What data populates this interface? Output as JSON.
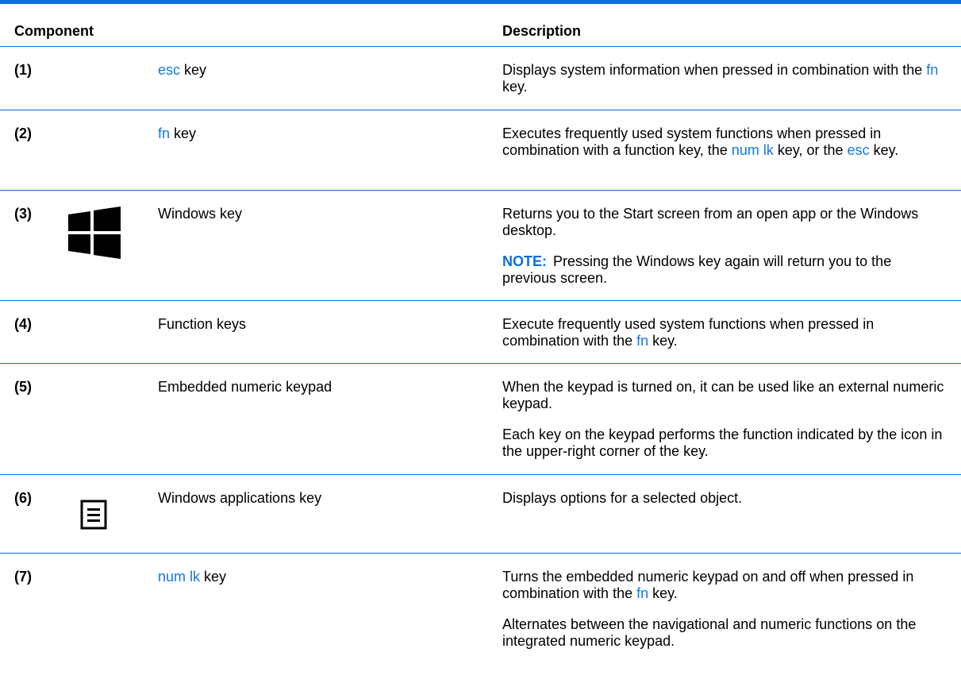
{
  "header": {
    "component": "Component",
    "description": "Description"
  },
  "rows": [
    {
      "num": "(1)",
      "component": {
        "prefix": "esc",
        "suffix": " key"
      },
      "description": [
        {
          "parts": [
            "Displays system information when pressed in combination with the ",
            "fn",
            " key."
          ]
        }
      ]
    },
    {
      "num": "(2)",
      "component": {
        "prefix": "fn",
        "suffix": " key"
      },
      "description": [
        {
          "parts": [
            "Executes frequently used system functions when pressed in combination with a function key, the ",
            "num lk",
            " key, or the ",
            "esc",
            " key."
          ]
        }
      ]
    },
    {
      "num": "(3)",
      "icon": "windows-logo-icon",
      "component": {
        "text": "Windows key"
      },
      "description": [
        {
          "text": "Returns you to the Start screen from an open app or the Windows desktop."
        },
        {
          "note_label": "NOTE:",
          "text": "Pressing the Windows key again will return you to the previous screen."
        }
      ]
    },
    {
      "num": "(4)",
      "component": {
        "text": "Function keys"
      },
      "description": [
        {
          "parts": [
            "Execute frequently used system functions when pressed in combination with the ",
            "fn",
            " key."
          ]
        }
      ]
    },
    {
      "num": "(5)",
      "component": {
        "text": "Embedded numeric keypad"
      },
      "description": [
        {
          "text": "When the keypad is turned on, it can be used like an external numeric keypad."
        },
        {
          "text": "Each key on the keypad performs the function indicated by the icon in the upper-right corner of the key."
        }
      ]
    },
    {
      "num": "(6)",
      "icon": "applications-key-icon",
      "component": {
        "text": "Windows applications key"
      },
      "description": [
        {
          "text": "Displays options for a selected object."
        }
      ]
    },
    {
      "num": "(7)",
      "component": {
        "prefix": "num lk",
        "suffix": " key"
      },
      "description": [
        {
          "parts": [
            "Turns the embedded numeric keypad on and off when pressed in combination with the ",
            "fn",
            " key."
          ]
        },
        {
          "text": "Alternates between the navigational and numeric functions on the integrated numeric keypad."
        }
      ]
    }
  ],
  "colors": {
    "rule": "#0a6fd6",
    "highlight": "#1479e0"
  }
}
